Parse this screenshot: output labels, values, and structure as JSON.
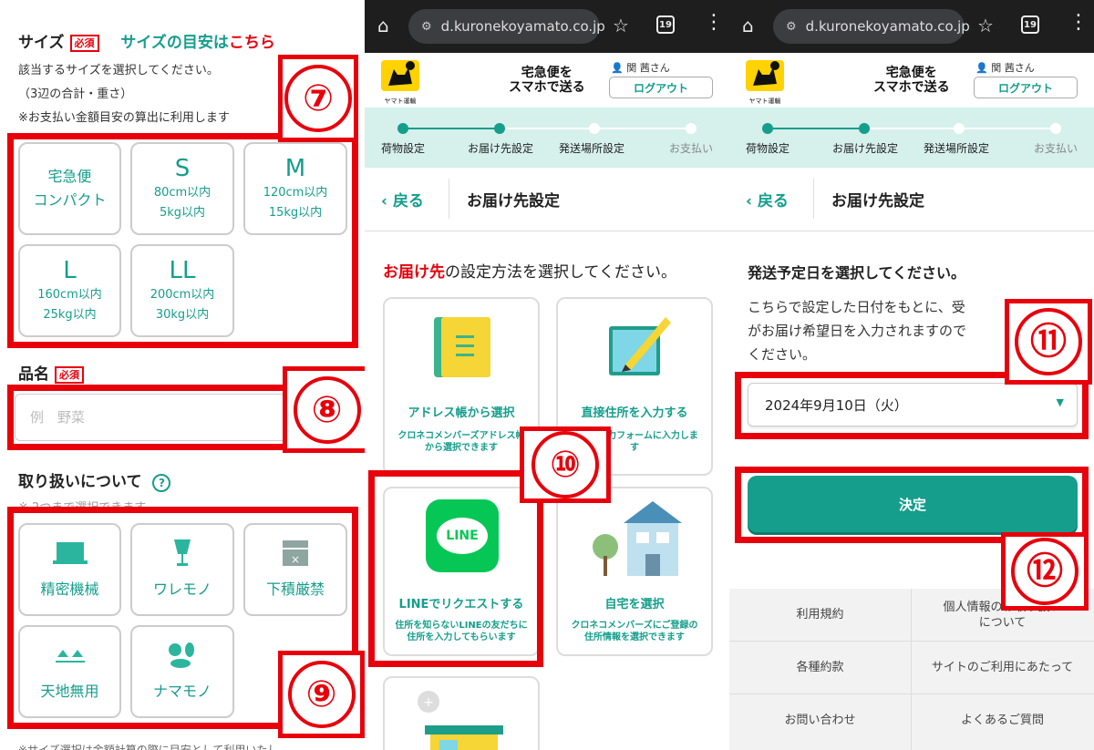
{
  "left": {
    "size_title": "サイズ",
    "required": "必須",
    "size_guide_pre": "サイズの目安は",
    "size_guide_link": "こちら",
    "size_desc1": "該当するサイズを選択してください。",
    "size_desc2": "（3辺の合計・重さ）",
    "size_desc3": "※お支払い金額目安の算出に利用します",
    "sizes": [
      {
        "name": "宅急便",
        "name2": "コンパクト"
      },
      {
        "name": "S",
        "l1": "80cm以内",
        "l2": "5kg以内"
      },
      {
        "name": "M",
        "l1": "120cm以内",
        "l2": "15kg以内"
      },
      {
        "name": "L",
        "l1": "160cm以内",
        "l2": "25kg以内"
      },
      {
        "name": "LL",
        "l1": "200cm以内",
        "l2": "30kg以内"
      }
    ],
    "item_title": "品名",
    "item_placeholder": "例　野菜",
    "handling_title": "取り扱いについて",
    "help": "?",
    "handling_note": "※ 2つまで選択できます",
    "handling": [
      {
        "label": "精密機械",
        "icon": "laptop-icon"
      },
      {
        "label": "ワレモノ",
        "icon": "broken-glass-icon"
      },
      {
        "label": "下積厳禁",
        "icon": "crushed-box-icon"
      },
      {
        "label": "天地無用",
        "icon": "up-arrows-icon"
      },
      {
        "label": "ナマモノ",
        "icon": "fresh-food-icon"
      }
    ],
    "bottom_note": "※サイズ選択は金額計算の際に目安として利用いたし"
  },
  "browser": {
    "url": "d.kuronekoyamato.co.jp",
    "tabs_count": "19"
  },
  "header": {
    "logo_text": "ヤマト運輸",
    "slogan1": "宅急便を",
    "slogan2": "スマホで送る",
    "user": "関 茜さん",
    "logout": "ログアウト"
  },
  "steps": [
    "荷物設定",
    "お届け先設定",
    "発送場所設定",
    "お支払い"
  ],
  "nav": {
    "back": "戻る",
    "title": "お届け先設定"
  },
  "middle": {
    "prompt_hl": "お届け先",
    "prompt_rest": "の設定方法を選択してください。",
    "options": [
      {
        "title": "アドレス帳から選択",
        "desc1": "クロネコメンバーズアドレス帳",
        "desc2": "から選択できます"
      },
      {
        "title": "直接住所を入力する",
        "desc1": "住所を入力フォームに入力しま",
        "desc2": "す"
      },
      {
        "title": "LINEでリクエストする",
        "desc1": "住所を知らないLINEの友だちに",
        "desc2": "住所を入力してもらいます",
        "logo": "LINE"
      },
      {
        "title": "自宅を選択",
        "desc1": "クロネコメンバーズにご登録の",
        "desc2": "住所情報を選択できます"
      }
    ]
  },
  "right": {
    "heading": "発送予定日を選択してください。",
    "desc1": "こちらで設定した日付をもとに、受",
    "desc2": "がお届け希望日を入力されますので",
    "desc3": "ください。",
    "date": "2024年9月10日（火）",
    "decide": "決定",
    "footer": [
      "利用規約",
      "個人情報のお取り扱いについて",
      "各種約款",
      "サイトのご利用にあたって",
      "お問い合わせ",
      "よくあるご質問"
    ]
  },
  "markers": [
    "⑦",
    "⑧",
    "⑨",
    "⑩",
    "⑪",
    "⑫"
  ],
  "colors": {
    "accent": "#159e8c",
    "highlight": "#e8000b"
  }
}
